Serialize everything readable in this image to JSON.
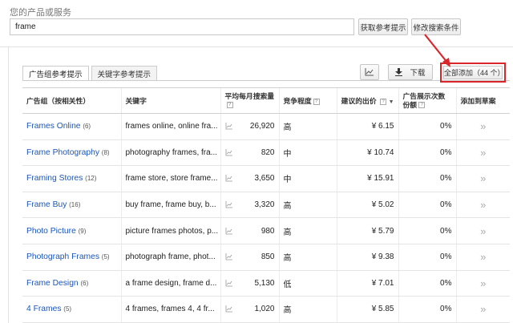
{
  "search": {
    "label": "您的产品或服务",
    "value": "frame",
    "get_ideas_button": "获取参考提示",
    "modify_search_button": "修改搜索条件"
  },
  "tabs": [
    {
      "label": "广告组参考提示",
      "active": true
    },
    {
      "label": "关键字参考提示",
      "active": false
    }
  ],
  "toolbar": {
    "chart_icon": "line-chart-icon",
    "download_icon": "download-icon",
    "download_label": "下载",
    "add_all_label": "全部添加（44 个）",
    "highlight_color": "#d9262a"
  },
  "table": {
    "headers": {
      "group": "广告组（按相关性）",
      "keywords": "关键字",
      "monthly_searches": "平均每月搜索量",
      "competition": "竞争程度",
      "suggested_bid": "建议的出价",
      "sort_indicator": "▼",
      "impression_share": "广告展示次数份额",
      "add": "添加到草案",
      "help": "?"
    },
    "rows": [
      {
        "group": "Frames Online",
        "count": "(6)",
        "keywords": "frames online, online fra...",
        "searches": "26,920",
        "competition": "高",
        "bid": "¥ 6.15",
        "share": "0%",
        "add": "»"
      },
      {
        "group": "Frame Photography",
        "count": "(8)",
        "keywords": "photography frames, fra...",
        "searches": "820",
        "competition": "中",
        "bid": "¥ 10.74",
        "share": "0%",
        "add": "»"
      },
      {
        "group": "Framing Stores",
        "count": "(12)",
        "keywords": "frame store, store frame...",
        "searches": "3,650",
        "competition": "中",
        "bid": "¥ 15.91",
        "share": "0%",
        "add": "»"
      },
      {
        "group": "Frame Buy",
        "count": "(16)",
        "keywords": "buy frame, frame buy, b...",
        "searches": "3,320",
        "competition": "高",
        "bid": "¥ 5.02",
        "share": "0%",
        "add": "»"
      },
      {
        "group": "Photo Picture",
        "count": "(9)",
        "keywords": "picture frames photos, p...",
        "searches": "980",
        "competition": "高",
        "bid": "¥ 5.79",
        "share": "0%",
        "add": "»"
      },
      {
        "group": "Photograph Frames",
        "count": "(5)",
        "keywords": "photograph frame, phot...",
        "searches": "850",
        "competition": "高",
        "bid": "¥ 9.38",
        "share": "0%",
        "add": "»"
      },
      {
        "group": "Frame Design",
        "count": "(6)",
        "keywords": "a frame design, frame d...",
        "searches": "5,130",
        "competition": "低",
        "bid": "¥ 7.01",
        "share": "0%",
        "add": "»"
      },
      {
        "group": "4 Frames",
        "count": "(5)",
        "keywords": "4 frames, frames 4, 4 fr...",
        "searches": "1,020",
        "competition": "高",
        "bid": "¥ 5.85",
        "share": "0%",
        "add": "»"
      }
    ]
  }
}
